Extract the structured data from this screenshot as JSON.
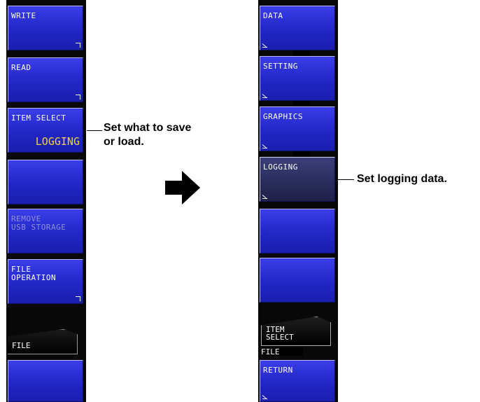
{
  "left_menu": {
    "write": "WRITE",
    "read": "READ",
    "item_select": {
      "label": "ITEM SELECT",
      "value": "LOGGING"
    },
    "remove_usb": "REMOVE\nUSB STORAGE",
    "file_operation": "FILE\nOPERATION",
    "file_tab": "FILE"
  },
  "right_menu": {
    "data": "DATA",
    "setting": "SETTING",
    "graphics": "GRAPHICS",
    "logging": "LOGGING",
    "item_select_tab": "ITEM\nSELECT",
    "file_sub": "FILE",
    "return": "RETURN"
  },
  "annotations": {
    "left_callout": "Set what to save\nor load.",
    "right_callout": "Set logging data."
  },
  "colors": {
    "softkey": "#2126c6",
    "value_text": "#f4d23a",
    "panel_bg": "#080808"
  },
  "icons": [
    "right-arrow-icon"
  ]
}
